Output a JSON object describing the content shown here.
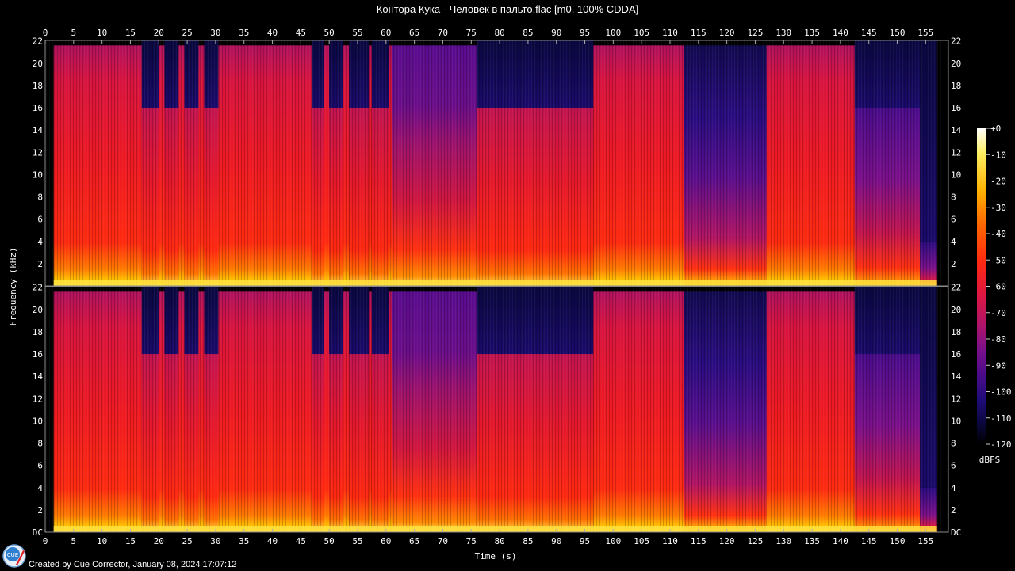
{
  "window": {
    "title": "Контора Кука - Человек в пальто.flac [m0, 100% CDDA]",
    "footer": "Created by Cue Corrector, January 08, 2024 17:07:12"
  },
  "logo": {
    "text": "CUE",
    "icon": "cue-corrector-logo-icon"
  },
  "colors": {
    "background": "#000000",
    "text": "#ffffff",
    "colormap": [
      "#000000",
      "#0b0840",
      "#1e0c78",
      "#4b0c8a",
      "#7a108a",
      "#b01468",
      "#e0173e",
      "#ff2a10",
      "#ff6a00",
      "#ffb000",
      "#fff060",
      "#ffffff"
    ]
  },
  "chart_data": {
    "type": "heatmap",
    "title": "Контора Кука - Человек в пальто.flac [m0, 100% CDDA]",
    "xlabel": "Time (s)",
    "ylabel": "Frequency (kHz)",
    "xlim": [
      0,
      159
    ],
    "ylim": [
      0,
      22.05
    ],
    "x_ticks": [
      "0",
      "5",
      "10",
      "15",
      "20",
      "25",
      "30",
      "35",
      "40",
      "45",
      "50",
      "55",
      "60",
      "65",
      "70",
      "75",
      "80",
      "85",
      "90",
      "95",
      "100",
      "105",
      "110",
      "115",
      "120",
      "125",
      "130",
      "135",
      "140",
      "145",
      "150",
      "155"
    ],
    "y_ticks_top": [
      "2",
      "4",
      "6",
      "8",
      "10",
      "12",
      "14",
      "16",
      "18",
      "20",
      "22"
    ],
    "y_ticks_bottom": [
      "DC",
      "2",
      "4",
      "6",
      "8",
      "10",
      "12",
      "14",
      "16",
      "18",
      "20",
      "22"
    ],
    "channels": 2,
    "colorbar": {
      "label": "dBFS",
      "range": [
        -120,
        0
      ],
      "ticks": [
        "+0",
        "-10",
        "-20",
        "-30",
        "-40",
        "-50",
        "-60",
        "-70",
        "-80",
        "-90",
        "-100",
        "-110",
        "-120"
      ]
    },
    "segments": [
      {
        "start": 1.5,
        "end": 17.0,
        "cutoff_khz": 22.0,
        "level": "loud"
      },
      {
        "start": 17.0,
        "end": 20.0,
        "cutoff_khz": 16.0,
        "level": "mid"
      },
      {
        "start": 20.0,
        "end": 21.0,
        "cutoff_khz": 22.0,
        "level": "loud"
      },
      {
        "start": 21.0,
        "end": 23.5,
        "cutoff_khz": 16.0,
        "level": "mid"
      },
      {
        "start": 23.5,
        "end": 24.5,
        "cutoff_khz": 22.0,
        "level": "loud"
      },
      {
        "start": 24.5,
        "end": 27.0,
        "cutoff_khz": 16.0,
        "level": "mid"
      },
      {
        "start": 27.0,
        "end": 28.0,
        "cutoff_khz": 22.0,
        "level": "loud"
      },
      {
        "start": 28.0,
        "end": 30.5,
        "cutoff_khz": 16.0,
        "level": "mid"
      },
      {
        "start": 30.5,
        "end": 47.0,
        "cutoff_khz": 22.0,
        "level": "loud"
      },
      {
        "start": 47.0,
        "end": 49.0,
        "cutoff_khz": 16.0,
        "level": "mid"
      },
      {
        "start": 49.0,
        "end": 50.0,
        "cutoff_khz": 22.0,
        "level": "loud"
      },
      {
        "start": 50.0,
        "end": 52.5,
        "cutoff_khz": 16.0,
        "level": "mid"
      },
      {
        "start": 52.5,
        "end": 53.5,
        "cutoff_khz": 22.0,
        "level": "loud"
      },
      {
        "start": 53.5,
        "end": 57.0,
        "cutoff_khz": 16.0,
        "level": "mid"
      },
      {
        "start": 57.0,
        "end": 57.5,
        "cutoff_khz": 22.0,
        "level": "loud"
      },
      {
        "start": 57.5,
        "end": 60.5,
        "cutoff_khz": 16.0,
        "level": "mid"
      },
      {
        "start": 60.5,
        "end": 61.0,
        "cutoff_khz": 22.0,
        "level": "loud"
      },
      {
        "start": 61.0,
        "end": 76.0,
        "cutoff_khz": 22.0,
        "level": "purple"
      },
      {
        "start": 76.0,
        "end": 96.5,
        "cutoff_khz": 16.0,
        "level": "mid"
      },
      {
        "start": 96.5,
        "end": 112.5,
        "cutoff_khz": 22.0,
        "level": "loud"
      },
      {
        "start": 112.5,
        "end": 127.0,
        "cutoff_khz": 22.0,
        "level": "quiet"
      },
      {
        "start": 127.0,
        "end": 142.5,
        "cutoff_khz": 22.0,
        "level": "loud"
      },
      {
        "start": 142.5,
        "end": 154.0,
        "cutoff_khz": 16.0,
        "level": "fade"
      },
      {
        "start": 154.0,
        "end": 157.0,
        "cutoff_khz": 4.0,
        "level": "tail"
      }
    ]
  }
}
